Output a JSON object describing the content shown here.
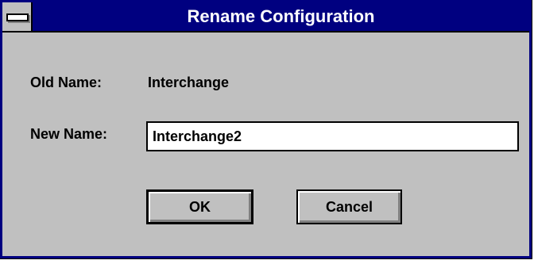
{
  "window": {
    "title": "Rename Configuration"
  },
  "form": {
    "old_name_label": "Old Name:",
    "old_name_value": "Interchange",
    "new_name_label": "New Name:",
    "new_name_value": "Interchange2"
  },
  "buttons": {
    "ok_label": "OK",
    "cancel_label": "Cancel"
  },
  "colors": {
    "titlebar": "#000080",
    "dialog_face": "#c0c0c0"
  },
  "icons": {
    "system_menu": "system-menu-icon"
  }
}
